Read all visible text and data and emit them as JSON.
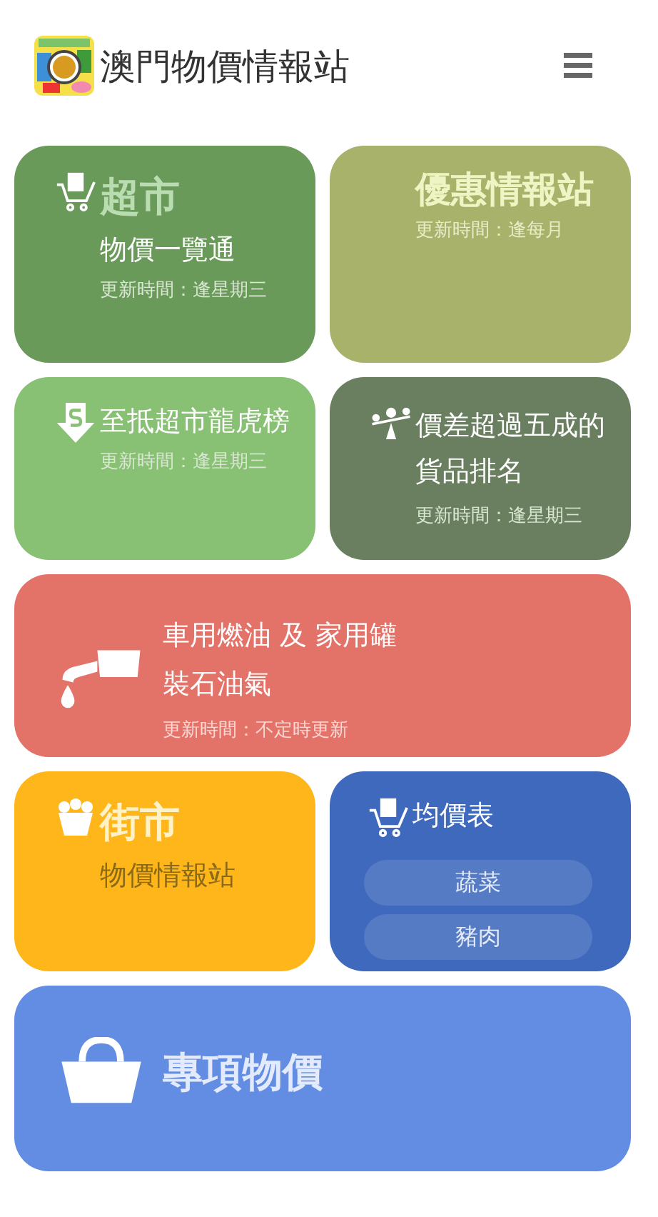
{
  "header": {
    "title": "澳門物價情報站"
  },
  "tiles": [
    {
      "kind": "supermarket",
      "color": "#6a9a5a",
      "title": "超市",
      "subtitle": "物價一覽通",
      "update": "更新時間：逢星期三"
    },
    {
      "kind": "offers",
      "color": "#a9b26a",
      "title": "優惠情報站",
      "update": "更新時間：逢每月"
    },
    {
      "kind": "ranking",
      "color": "#88c074",
      "title": "至抵超市龍虎榜",
      "update": "更新時間：逢星期三"
    },
    {
      "kind": "difference",
      "color": "#6a7f5f",
      "title": "價差超過五成的貨品排名",
      "update": "更新時間：逢星期三"
    },
    {
      "kind": "fuel",
      "color": "#e37268",
      "title": "車用燃油 及 家用罐裝石油氣",
      "update": "更新時間：不定時更新"
    },
    {
      "kind": "market",
      "color": "#ffb61a",
      "title": "街市",
      "subtitle": "物價情報站"
    },
    {
      "kind": "average",
      "color": "#3f69bd",
      "title": "均價表",
      "links": [
        "蔬菜",
        "豬肉"
      ]
    },
    {
      "kind": "special",
      "color": "#628de2",
      "title": "專項物價"
    }
  ]
}
